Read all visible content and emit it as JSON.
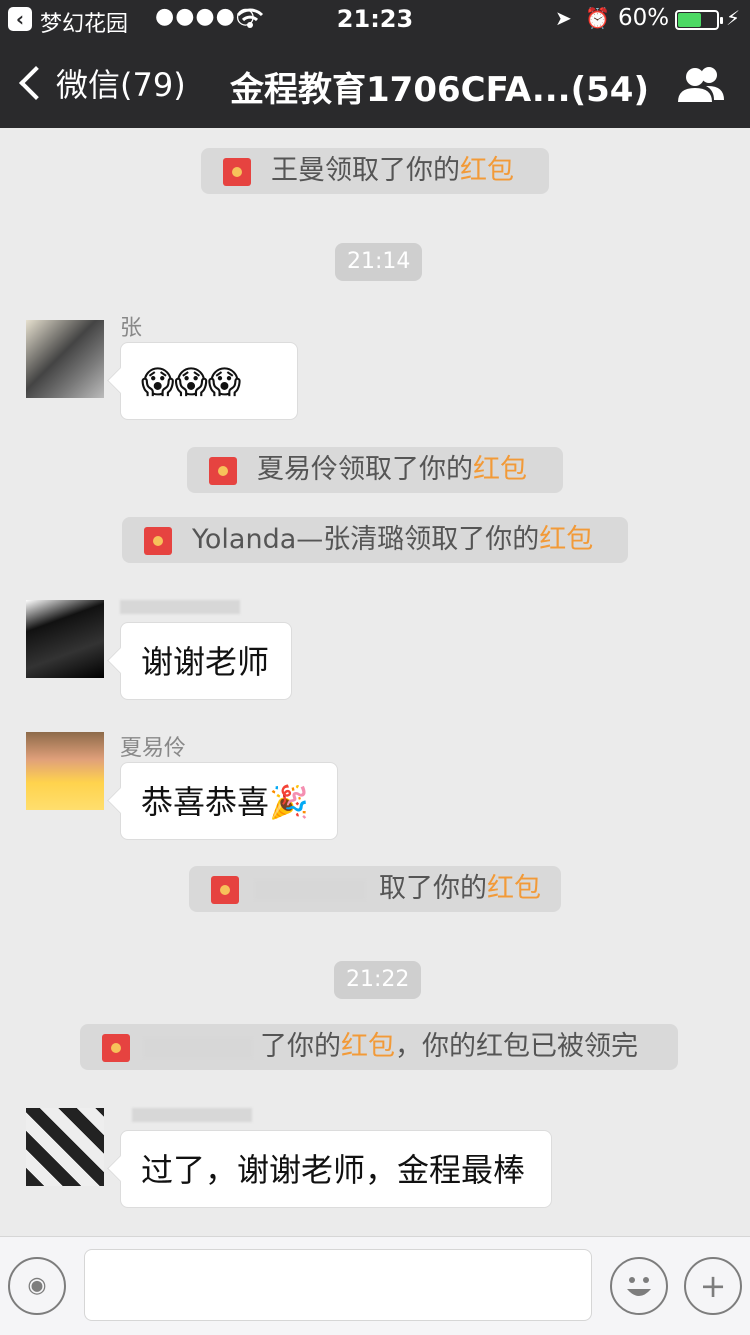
{
  "status_bar": {
    "carrier": "梦幻花园",
    "signal": "●●●●○",
    "time": "21:23",
    "battery_pct": "60%",
    "battery_level": 0.6
  },
  "nav": {
    "back_label": "微信(79)",
    "title": "金程教育1706CFA...(54)"
  },
  "messages": {
    "sys1": {
      "pre": "王曼领取了你的",
      "link": "红包"
    },
    "time1": "21:14",
    "msg1": {
      "sender": "张",
      "text": "😱😱😱"
    },
    "sys2": {
      "pre": "夏易伶领取了你的",
      "link": "红包"
    },
    "sys3": {
      "pre": "Yolanda—张清璐领取了你的",
      "link": "红包"
    },
    "msg2": {
      "text": "谢谢老师"
    },
    "msg3": {
      "sender": "夏易伶",
      "text": "恭喜恭喜🎉"
    },
    "sys4": {
      "pre": "取了你的",
      "link": "红包"
    },
    "time2": "21:22",
    "sys5": {
      "pre": "了你的",
      "link": "红包",
      "post": "，你的红包已被领完"
    },
    "msg4": {
      "text": "过了，谢谢老师，金程最棒"
    }
  },
  "colors": {
    "nav_bg": "#2a2a2c",
    "chat_bg": "#ebebeb",
    "redpacket_link": "#f29a38",
    "battery": "#4cd964"
  }
}
